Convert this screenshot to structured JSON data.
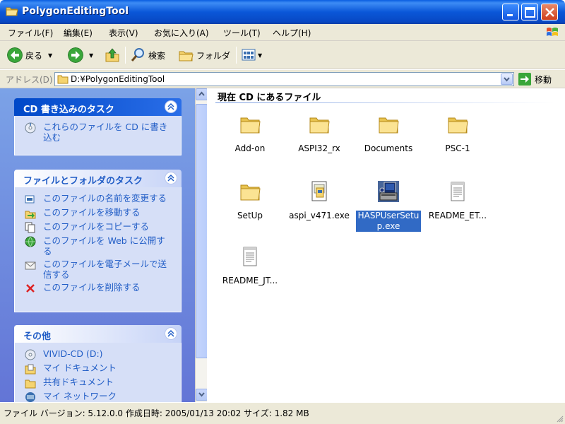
{
  "window": {
    "title": "PolygonEditingTool"
  },
  "menu": {
    "items": [
      "ファイル(F)",
      "編集(E)",
      "表示(V)",
      "お気に入り(A)",
      "ツール(T)",
      "ヘルプ(H)"
    ]
  },
  "toolbar": {
    "back_label": "戻る",
    "search_label": "検索",
    "folders_label": "フォルダ"
  },
  "address": {
    "label": "アドレス(D)",
    "value": "D:¥PolygonEditingTool",
    "go_label": "移動"
  },
  "taskpane": {
    "cd_panel": {
      "title": "CD 書き込みのタスク",
      "tasks": [
        "これらのファイルを CD に書き\n込む"
      ]
    },
    "file_panel": {
      "title": "ファイルとフォルダのタスク",
      "tasks": [
        "このファイルの名前を変更する",
        "このファイルを移動する",
        "このファイルをコピーする",
        "このファイルを Web に公開す\nる",
        "このファイルを電子メールで送\n信する",
        "このファイルを削除する"
      ]
    },
    "other_panel": {
      "title": "その他",
      "items": [
        "VIVID-CD (D:)",
        "マイ ドキュメント",
        "共有ドキュメント",
        "マイ ネットワーク"
      ]
    }
  },
  "content": {
    "group_title": "現在 CD にあるファイル",
    "files": [
      {
        "name": "Add-on",
        "icon": "folder-icon"
      },
      {
        "name": "ASPI32_rx",
        "icon": "folder-icon"
      },
      {
        "name": "Documents",
        "icon": "folder-icon"
      },
      {
        "name": "PSC-1",
        "icon": "folder-icon"
      },
      {
        "name": "SetUp",
        "icon": "folder-icon"
      },
      {
        "name": "aspi_v471.exe",
        "icon": "installer-icon"
      },
      {
        "name": "HASPUserSetup.exe",
        "icon": "setup-exe-icon",
        "selected": true
      },
      {
        "name": "README_ET...",
        "icon": "text-file-icon"
      },
      {
        "name": "README_JT...",
        "icon": "text-file-icon"
      }
    ]
  },
  "status": {
    "text": "ファイル バージョン: 5.12.0.0 作成日時: 2005/01/13 20:02 サイズ: 1.82 MB"
  },
  "colors": {
    "title_bar": "#0a57d8",
    "task_link": "#215dc6",
    "selection": "#316ac5"
  }
}
